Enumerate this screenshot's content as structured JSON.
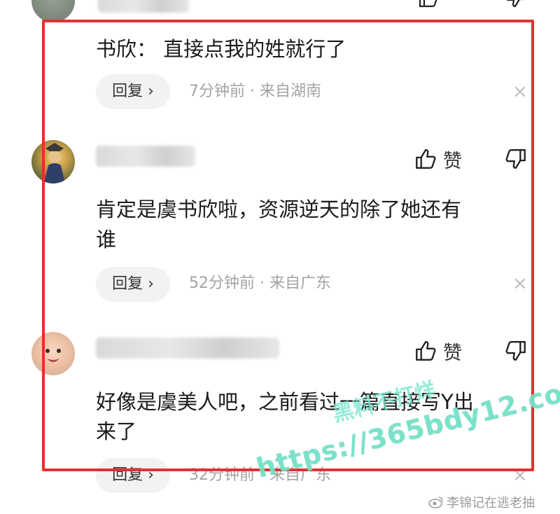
{
  "comments": [
    {
      "name": "",
      "text_lines": [
        "书欣：  直接点我的姓就行了"
      ],
      "reply_label": "回复 ›",
      "meta": "7分钟前 · 来自湖南",
      "like_label": ""
    },
    {
      "name": "",
      "text_lines": [
        "肯定是虞书欣啦，资源逆天的除了她还有",
        "谁"
      ],
      "reply_label": "回复 ›",
      "meta": "52分钟前 · 来自广东",
      "like_label": "赞"
    },
    {
      "name": "",
      "text_lines": [
        "好像是虞美人吧，之前看过一篇直接写Y出",
        "来了"
      ],
      "reply_label": "回复 ›",
      "meta": "32分钟前 · 来自广东",
      "like_label": "赞"
    }
  ],
  "close_symbol": "×",
  "watermark": {
    "url": "https://365bdy12.com",
    "text": "黑料不打烊",
    "weibo": "李锦记在逃老抽"
  },
  "colors": {
    "frame": "#e53030",
    "watermark": "#78e6cd",
    "meta_text": "#a3a3a3"
  },
  "icons": [
    "thumbs-up-icon",
    "thumbs-down-icon",
    "close-icon",
    "weibo-icon"
  ]
}
